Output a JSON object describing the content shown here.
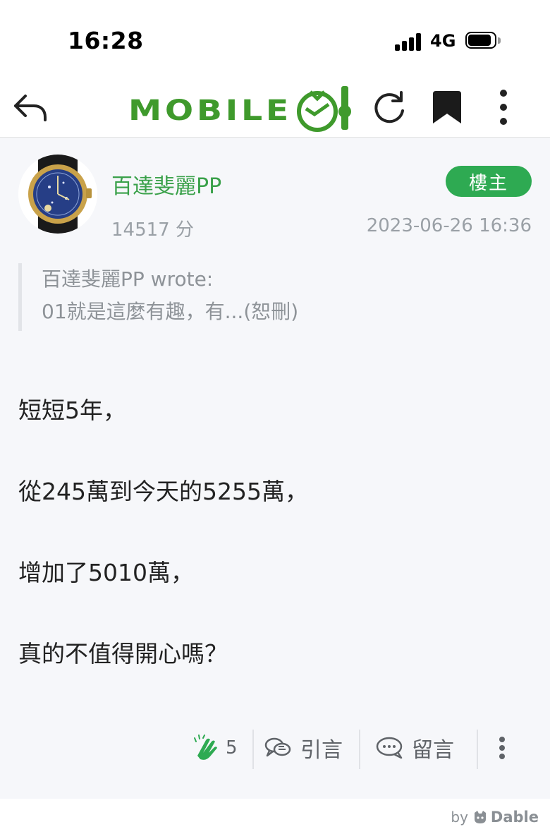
{
  "status_bar": {
    "time": "16:28",
    "network": "4G"
  },
  "nav": {
    "logo_text": "MOBILE01"
  },
  "post": {
    "author": "百達斐麗PP",
    "badge": "樓主",
    "points": "14517 分",
    "date": "2023-06-26 16:36",
    "quote": {
      "line1": "百達斐麗PP wrote:",
      "line2": "01就是這麼有趣，有...(恕刪)"
    },
    "body": [
      "短短5年，",
      "從245萬到今天的5255萬，",
      "增加了5010萬，",
      "真的不值得開心嗎？"
    ]
  },
  "actions": {
    "clap_count": "5",
    "quote_label": "引言",
    "comment_label": "留言"
  },
  "footer": {
    "by": "by",
    "brand": "Dable"
  },
  "colors": {
    "accent_green": "#2eaa52",
    "author_green": "#3aa14a",
    "muted": "#9aa0a6"
  }
}
